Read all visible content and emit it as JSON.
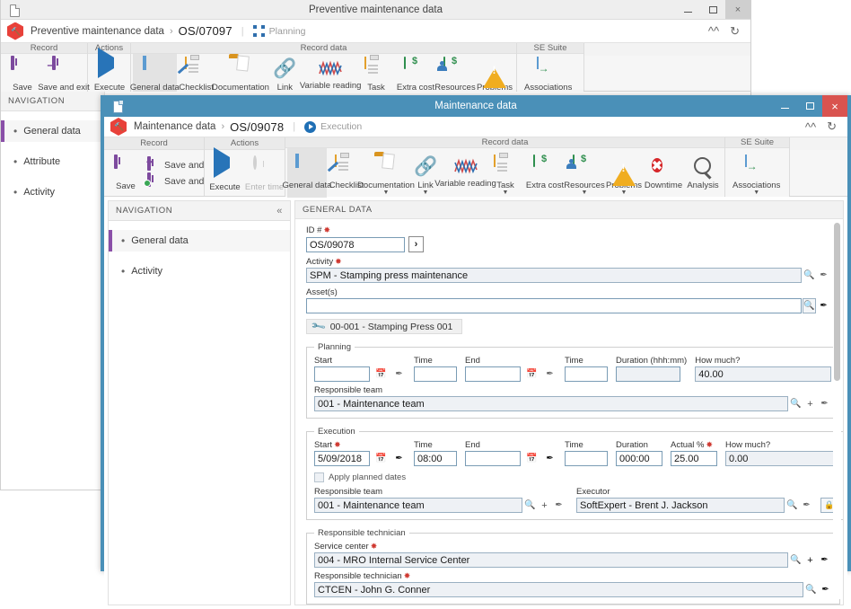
{
  "background_window": {
    "titlebar": {
      "title": "Preventive maintenance data",
      "doc_icon": "document-icon",
      "minimize": "–",
      "maximize": "□",
      "close": "×"
    },
    "breadcrumb": {
      "logo_icon": "hammer-hex-logo",
      "module": "Preventive maintenance data",
      "separator": "›",
      "record_id": "OS/07097",
      "divider": "|",
      "stage_icon": "planning-icon",
      "stage": "Planning",
      "collapse_icon": "chevron-up-icon",
      "refresh_icon": "refresh-icon"
    },
    "ribbon": [
      {
        "title": "Record",
        "items": [
          {
            "label": "Save",
            "icon": "save-icon"
          },
          {
            "label": "Save and exit",
            "icon": "save-and-exit-icon"
          }
        ]
      },
      {
        "title": "Actions",
        "items": [
          {
            "label": "Execute",
            "icon": "play-icon"
          }
        ]
      },
      {
        "title": "Record data",
        "items": [
          {
            "label": "General data",
            "icon": "window-icon",
            "selected": true
          },
          {
            "label": "Checklist",
            "icon": "checklist-icon"
          },
          {
            "label": "Documentation",
            "icon": "folder-icon",
            "caret": true
          },
          {
            "label": "Link",
            "icon": "link-icon",
            "caret": true
          },
          {
            "label": "Variable reading",
            "icon": "chart-zigzag-icon"
          },
          {
            "label": "Task",
            "icon": "clipboard-icon",
            "caret": true
          },
          {
            "label": "Extra cost",
            "icon": "money-icon"
          },
          {
            "label": "Resources",
            "icon": "money-people-icon",
            "caret": true
          },
          {
            "label": "Problems",
            "icon": "warning-icon",
            "caret": true
          }
        ]
      },
      {
        "title": "SE Suite",
        "items": [
          {
            "label": "Associations",
            "icon": "associations-icon",
            "caret": true
          }
        ]
      }
    ],
    "navigation": {
      "header": "NAVIGATION",
      "items": [
        {
          "label": "General data",
          "active": true
        },
        {
          "label": "Attribute",
          "active": false
        },
        {
          "label": "Activity",
          "active": false
        }
      ]
    }
  },
  "foreground_window": {
    "titlebar": {
      "title": "Maintenance data",
      "doc_icon": "document-icon",
      "minimize": "–",
      "maximize": "□",
      "close": "×"
    },
    "breadcrumb": {
      "logo_icon": "hammer-hex-logo",
      "module": "Maintenance data",
      "separator": "›",
      "record_id": "OS/09078",
      "divider": "|",
      "stage_icon": "execution-play-icon",
      "stage": "Execution",
      "collapse_icon": "chevron-up-icon",
      "refresh_icon": "refresh-icon"
    },
    "ribbon": [
      {
        "title": "Record",
        "main": {
          "label": "Save",
          "icon": "save-icon"
        },
        "sub": [
          {
            "label": "Save and exit",
            "icon": "save-and-exit-icon"
          },
          {
            "label": "Save and new",
            "icon": "save-and-new-icon"
          }
        ]
      },
      {
        "title": "Actions",
        "items": [
          {
            "label": "Execute",
            "icon": "play-icon",
            "disabled": false
          },
          {
            "label": "Enter time",
            "icon": "clock-icon",
            "disabled": true
          }
        ]
      },
      {
        "title": "Record data",
        "items": [
          {
            "label": "General data",
            "icon": "window-icon",
            "selected": true
          },
          {
            "label": "Checklist",
            "icon": "checklist-icon"
          },
          {
            "label": "Documentation",
            "icon": "folder-icon",
            "caret": true
          },
          {
            "label": "Link",
            "icon": "link-icon",
            "caret": true
          },
          {
            "label": "Variable reading",
            "icon": "chart-zigzag-icon"
          },
          {
            "label": "Task",
            "icon": "clipboard-icon",
            "caret": true
          },
          {
            "label": "Extra cost",
            "icon": "money-icon"
          },
          {
            "label": "Resources",
            "icon": "money-people-icon",
            "caret": true
          },
          {
            "label": "Problems",
            "icon": "warning-icon",
            "caret": true
          },
          {
            "label": "Downtime",
            "icon": "stop-icon"
          },
          {
            "label": "Analysis",
            "icon": "magnifier-icon"
          }
        ]
      },
      {
        "title": "SE Suite",
        "items": [
          {
            "label": "Associations",
            "icon": "associations-icon",
            "caret": true
          }
        ]
      }
    ],
    "navigation": {
      "header": "NAVIGATION",
      "collapse_icon": "double-chevron-left-icon",
      "items": [
        {
          "label": "General data",
          "active": true
        },
        {
          "label": "Activity",
          "active": false
        }
      ]
    },
    "form": {
      "section_title": "GENERAL DATA",
      "id": {
        "label": "ID #",
        "required": true,
        "value": "OS/09078",
        "next_icon": "chevron-right-icon"
      },
      "activity": {
        "label": "Activity",
        "required": true,
        "value": "SPM - Stamping press maintenance",
        "magnifier_icon": "search-icon",
        "brush_icon": "brush-icon"
      },
      "assets": {
        "label": "Asset(s)",
        "value": "",
        "magnifier_icon": "search-icon",
        "brush_icon": "brush-icon",
        "chips": [
          {
            "icon": "wrench-icon",
            "label": "00-001 - Stamping Press 001"
          }
        ]
      },
      "planning": {
        "legend": "Planning",
        "start": {
          "label": "Start",
          "value": "",
          "calendar_icon": "calendar-icon",
          "brush_icon": "brush-icon"
        },
        "start_time": {
          "label": "Time",
          "value": ""
        },
        "end": {
          "label": "End",
          "value": "",
          "calendar_icon": "calendar-icon",
          "brush_icon": "brush-icon"
        },
        "end_time": {
          "label": "Time",
          "value": ""
        },
        "duration": {
          "label": "Duration (hhh:mm)",
          "value": ""
        },
        "how_much": {
          "label": "How much?",
          "value": "40.00"
        },
        "responsible_team": {
          "label": "Responsible team",
          "value": "001 - Maintenance team",
          "magnifier_icon": "search-icon",
          "plus_icon": "plus-icon",
          "brush_icon": "brush-icon"
        }
      },
      "execution": {
        "legend": "Execution",
        "start": {
          "label": "Start",
          "required": true,
          "value": "5/09/2018",
          "calendar_icon": "calendar-icon",
          "brush_icon": "brush-icon"
        },
        "start_time": {
          "label": "Time",
          "value": "08:00"
        },
        "end": {
          "label": "End",
          "value": "",
          "calendar_icon": "calendar-icon",
          "brush_icon": "brush-icon"
        },
        "end_time": {
          "label": "Time",
          "value": ""
        },
        "duration": {
          "label": "Duration",
          "value": "000:00"
        },
        "actual_pct": {
          "label": "Actual %",
          "required": true,
          "value": "25.00"
        },
        "how_much": {
          "label": "How much?",
          "value": "0.00"
        },
        "apply_planned_dates": {
          "label": "Apply planned dates",
          "checked": false
        },
        "responsible_team": {
          "label": "Responsible team",
          "value": "001 - Maintenance team",
          "magnifier_icon": "search-icon",
          "plus_icon": "plus-icon",
          "brush_icon": "brush-icon"
        },
        "executor": {
          "label": "Executor",
          "value": "SoftExpert - Brent J. Jackson",
          "magnifier_icon": "search-icon",
          "brush_icon": "brush-icon",
          "lock_icon": "lock-icon"
        }
      },
      "responsible_technician": {
        "legend": "Responsible technician",
        "service_center": {
          "label": "Service center",
          "required": true,
          "value": "004 - MRO Internal Service Center",
          "magnifier_icon": "search-icon",
          "plus_icon": "plus-icon",
          "brush_icon": "brush-icon"
        },
        "technician": {
          "label": "Responsible technician",
          "required": true,
          "value": "CTCEN - John G. Conner",
          "magnifier_icon": "search-icon",
          "brush_icon": "brush-icon"
        }
      }
    }
  },
  "colors": {
    "active_title_bg": "#4a90b8",
    "close_active_bg": "#d9534f",
    "accent_purple": "#8a4fa8",
    "required_red": "#cf3a32",
    "ribbon_bg": "#f3f3f3"
  }
}
